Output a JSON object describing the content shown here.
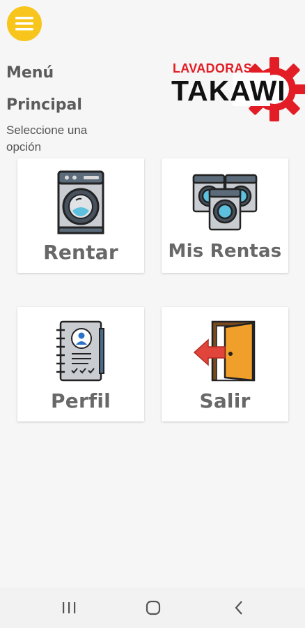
{
  "header": {
    "menu_icon": "hamburger-menu-icon",
    "title_line1": "Menú",
    "title_line2": "Principal",
    "subtitle": "Seleccione una opción"
  },
  "logo": {
    "top_text": "LAVADORAS",
    "main_text": "TAKAWI",
    "gear_color": "#e21d25"
  },
  "menu_options": [
    {
      "label": "Rentar",
      "icon": "washing-machine-icon"
    },
    {
      "label": "Mis Rentas",
      "icon": "washing-machines-icon"
    },
    {
      "label": "Perfil",
      "icon": "profile-notebook-icon"
    },
    {
      "label": "Salir",
      "icon": "exit-door-icon"
    }
  ],
  "navbar": {
    "recents_icon": "recents-icon",
    "home_icon": "home-icon",
    "back_icon": "back-icon"
  },
  "colors": {
    "accent": "#f7c51b",
    "background": "#f6f6f6",
    "label": "#686868"
  }
}
